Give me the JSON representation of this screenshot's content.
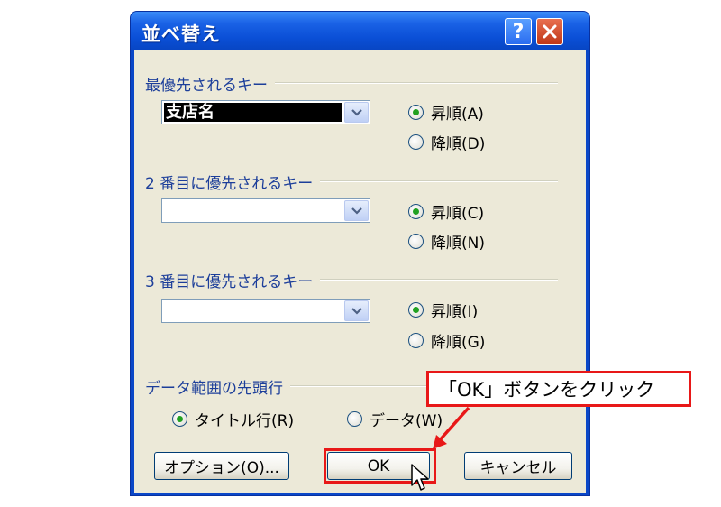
{
  "dialog": {
    "title": "並べ替え",
    "help_glyph": "?",
    "close_glyph": "✕"
  },
  "key1": {
    "label": "最優先されるキー",
    "value": "支店名",
    "asc": "昇順(A)",
    "desc": "降順(D)",
    "selected": "asc"
  },
  "key2": {
    "label": "2 番目に優先されるキー",
    "value": "",
    "asc": "昇順(C)",
    "desc": "降順(N)",
    "selected": "asc"
  },
  "key3": {
    "label": "3 番目に優先されるキー",
    "value": "",
    "asc": "昇順(I)",
    "desc": "降順(G)",
    "selected": "asc"
  },
  "header_row": {
    "label": "データ範囲の先頭行",
    "title_row": "タイトル行(R)",
    "data_row": "データ(W)",
    "selected": "title_row"
  },
  "buttons": {
    "options": "オプション(O)...",
    "ok": "OK",
    "cancel": "キャンセル"
  },
  "annotation": {
    "text": "「OK」ボタンをクリック",
    "color": "#e81818"
  }
}
